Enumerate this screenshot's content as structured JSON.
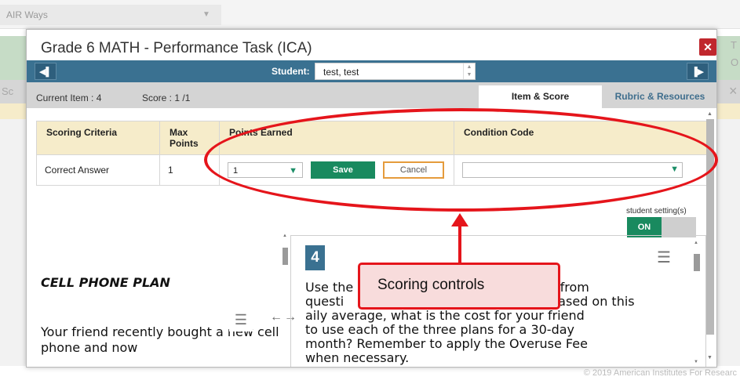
{
  "background": {
    "app_tab": "AIR Ways",
    "edge_left": "Sc",
    "edge_right_top": "T",
    "edge_right_bottom": "O",
    "close_glyph": "×",
    "footer": "© 2019 American Institutes For Researc"
  },
  "modal": {
    "title": "Grade 6 MATH - Performance Task (ICA)",
    "close_icon": "close-icon",
    "nav": {
      "student_label": "Student:",
      "student_value": "test, test",
      "prev_icon": "prev-student-icon",
      "next_icon": "next-student-icon"
    },
    "info": {
      "current_item": "Current Item : 4",
      "score": "Score : 1 /1"
    },
    "tabs": [
      {
        "label": "Item & Score",
        "active": true
      },
      {
        "label": "Rubric & Resources",
        "active": false
      }
    ],
    "scoring_table": {
      "headers": [
        "Scoring Criteria",
        "Max Points",
        "Points Earned",
        "Condition Code"
      ],
      "row": {
        "criteria": "Correct Answer",
        "max": "1",
        "points_selected": "1",
        "save_label": "Save",
        "cancel_label": "Cancel",
        "condition_selected": ""
      }
    },
    "student_setting": {
      "label": "student setting(s)",
      "toggle": "ON"
    },
    "left_pane": {
      "title": "CELL PHONE PLAN",
      "body": "Your friend recently bought a new cell phone and now"
    },
    "right_pane": {
      "question_number": "4",
      "text_line1": "Use the",
      "text_line1b": "s from",
      "text_line2": "questi",
      "text_line2b": "Based on this",
      "text_line3": "aily average, what is the cost for your friend",
      "text_line4": "to use each of the three plans for a 30-day",
      "text_line5": "month? Remember to apply the Overuse Fee",
      "text_line6": "when necessary."
    }
  },
  "annotation": {
    "callout": "Scoring controls",
    "color": "#e5151b"
  },
  "colors": {
    "nav_blue": "#3a7191",
    "accent_green": "#198a5f",
    "header_yellow": "#f6ecca",
    "close_red": "#c0272d"
  }
}
